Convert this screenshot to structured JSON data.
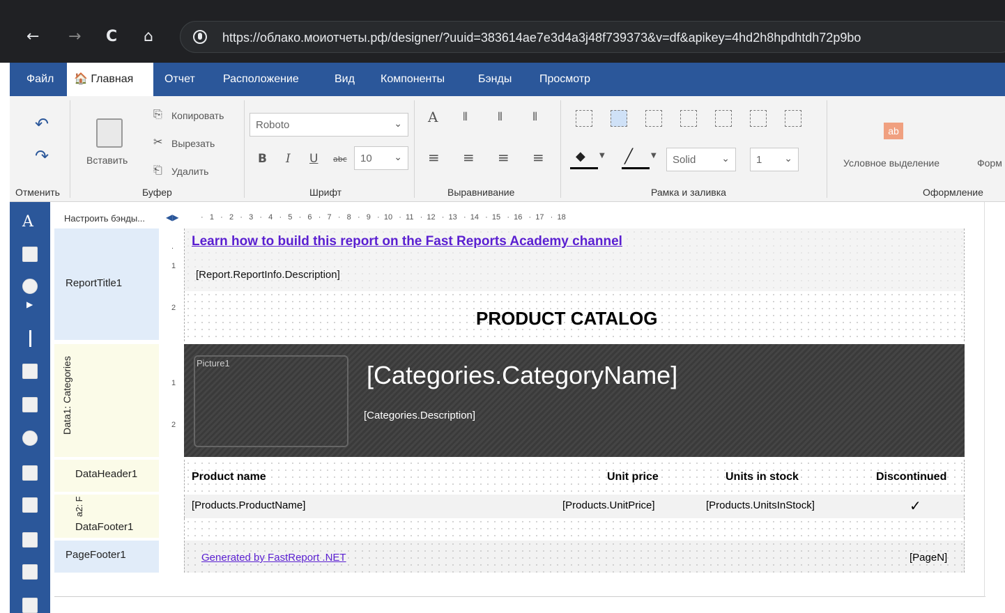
{
  "browser": {
    "url": "https://облако.моиотчеты.рф/designer/?uuid=383614ae7e3d4a3j48f739373&v=df&apikey=4hd2h8hpdhtdh72p9bo",
    "back": "←",
    "forward": "→",
    "reload": "C",
    "home": "⌂"
  },
  "menu": {
    "file": "Файл",
    "home": "🏠 Главная",
    "report": "Отчет",
    "layout": "Расположение",
    "view": "Вид",
    "components": "Компоненты",
    "bands": "Бэнды",
    "preview": "Просмотр"
  },
  "ribbon": {
    "undo_group": "Отменить",
    "clipboard_group": "Буфер",
    "font_group": "Шрифт",
    "align_group": "Выравнивание",
    "border_group": "Рамка и заливка",
    "style_group": "Оформление",
    "paste": "Вставить",
    "copy": "Копировать",
    "cut": "Вырезать",
    "delete": "Удалить",
    "font_name": "Roboto",
    "font_size": "10",
    "bold": "B",
    "italic": "I",
    "underline": "U",
    "strike": "abc",
    "line_style": "Solid",
    "line_width": "1",
    "conditional": "Условное выделение",
    "format": "Форм"
  },
  "designer": {
    "bands_config": "Настроить бэнды...",
    "ruler": "·   1   ·   2   ·   3   ·   4   ·   5   ·   6   ·   7   ·   8   ·   9   ·  10   ·  11   ·  12   ·  13   ·  14   ·  15   ·  16   ·  17   ·  18",
    "bands": {
      "report_title": "ReportTitle1",
      "data_categories": "Data1: Categories",
      "data_header": "DataHeader1",
      "data2": "a2: F",
      "data_footer": "DataFooter1",
      "page_footer": "PageFooter1"
    },
    "vruler_nums": {
      "one": "1",
      "two": "2",
      "dot": "."
    },
    "link": "Learn how to build this report on the Fast Reports Academy channel",
    "description": "[Report.ReportInfo.Description]",
    "title": "PRODUCT CATALOG",
    "picture": "Picture1",
    "category_name": "[Categories.CategoryName]",
    "category_desc": "[Categories.Description]",
    "headers": {
      "product_name": "Product name",
      "unit_price": "Unit price",
      "units_in_stock": "Units in stock",
      "discontinued": "Discontinued"
    },
    "fields": {
      "product_name": "[Products.ProductName]",
      "unit_price": "[Products.UnitPrice]",
      "units_in_stock": "[Products.UnitsInStock]",
      "discontinued_check": "✓"
    },
    "footer_link": "Generated by FastReport .NET",
    "page_n": "[PageN]"
  },
  "colors": {
    "accent": "#2b579a",
    "band_title": "#e1ecf9",
    "band_data": "#fbfbe8",
    "category_bg": "#3a3a3a"
  }
}
